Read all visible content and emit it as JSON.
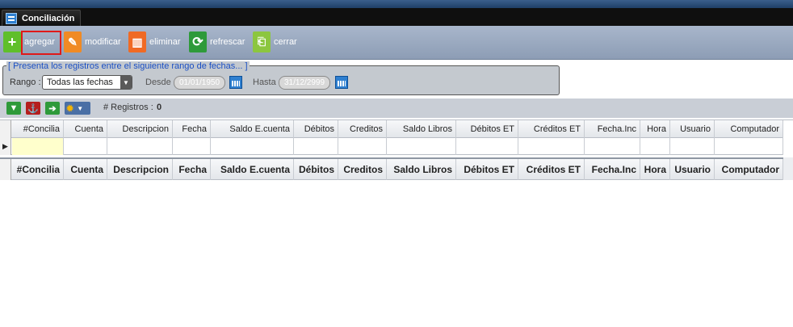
{
  "window": {
    "tab_title": "Conciliación"
  },
  "toolbar": {
    "agregar": "agregar",
    "modificar": "modificar",
    "eliminar": "eliminar",
    "refrescar": "refrescar",
    "cerrar": "cerrar"
  },
  "filter": {
    "legend": "[ Presenta los registros entre el siguiente rango de fechas... ]",
    "rango_label": "Rango :",
    "rango_value": "Todas las fechas",
    "desde_label": "Desde",
    "desde_value": "01/01/1950",
    "hasta_label": "Hasta",
    "hasta_value": "31/12/2999"
  },
  "records": {
    "label": "# Registros :",
    "count": "0"
  },
  "columns": [
    "#Concilia",
    "Cuenta",
    "Descripcion",
    "Fecha",
    "Saldo E.cuenta",
    "Débitos",
    "Creditos",
    "Saldo Libros",
    "Débitos ET",
    "Créditos ET",
    "Fecha.Inc",
    "Hora",
    "Usuario",
    "Computador"
  ],
  "colors": {
    "toolbar": "#8d9db5",
    "highlight": "#e01919",
    "active_cell": "#ffffcc"
  }
}
